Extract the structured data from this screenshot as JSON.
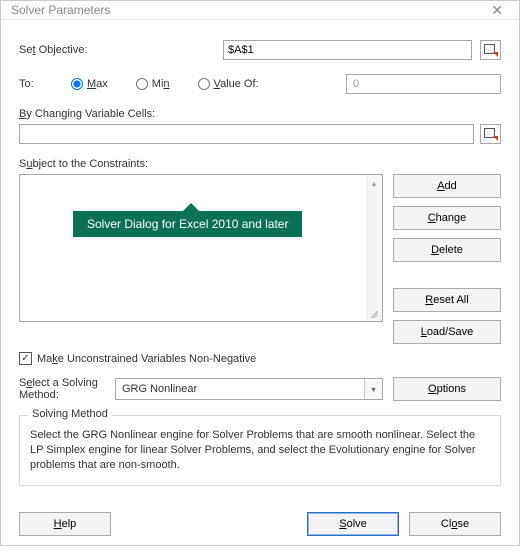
{
  "title": "Solver Parameters",
  "objective": {
    "label_pre": "Se",
    "label_ul": "t",
    "label_post": " Objective:",
    "value": "$A$1"
  },
  "to": {
    "label": "To:",
    "max_ul": "M",
    "max_rest": "ax",
    "min_rest": "Mi",
    "min_ul": "n",
    "valueof_ul": "V",
    "valueof_rest": "alue Of:",
    "value_input": "0"
  },
  "changing": {
    "ul": "B",
    "rest": "y Changing Variable Cells:",
    "value": ""
  },
  "constraints": {
    "label_pre": "S",
    "label_ul": "u",
    "label_post": "bject to the Constraints:",
    "tooltip": "Solver Dialog for Excel 2010 and later"
  },
  "buttons": {
    "add_ul": "A",
    "add_rest": "dd",
    "change_ul": "C",
    "change_rest": "hange",
    "delete_ul": "D",
    "delete_rest": "elete",
    "reset_ul": "R",
    "reset_rest": "eset All",
    "load_ul": "L",
    "load_rest": "oad/Save",
    "options_ul": "O",
    "options_rest": "ptions",
    "help_ul": "H",
    "help_rest": "elp",
    "solve_ul": "S",
    "solve_rest": "olve",
    "close_pre": "Cl",
    "close_ul": "o",
    "close_post": "se"
  },
  "nonneg": {
    "pre": "Ma",
    "ul": "k",
    "post": "e Unconstrained Variables Non-Negative",
    "checked": true
  },
  "method": {
    "label_pre": "S",
    "label_ul": "e",
    "label_post": "lect a Solving Method:",
    "value": "GRG Nonlinear"
  },
  "desc": {
    "title": "Solving Method",
    "text": "Select the GRG Nonlinear engine for Solver Problems that are smooth nonlinear. Select the LP Simplex engine for linear Solver Problems, and select the Evolutionary engine for Solver problems that are non-smooth."
  }
}
